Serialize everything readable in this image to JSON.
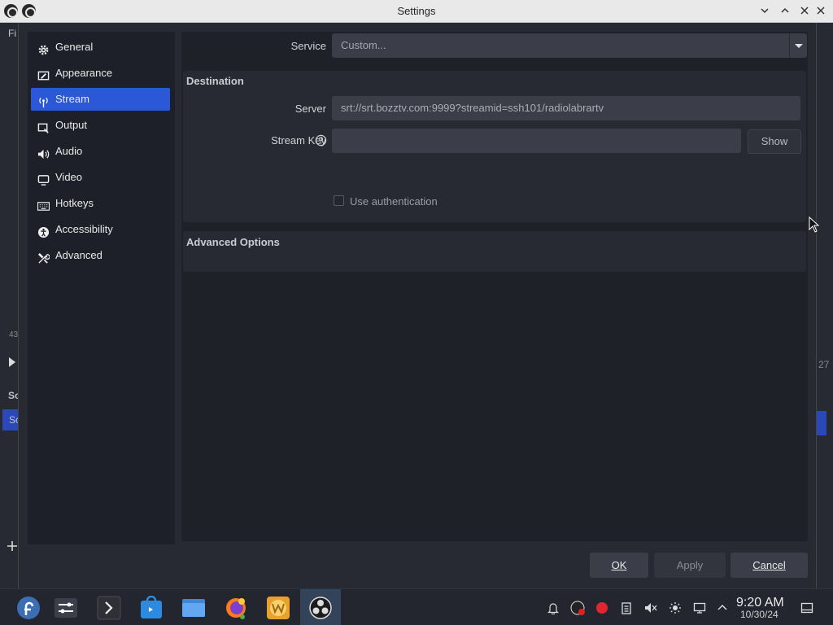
{
  "window": {
    "title": "Settings",
    "background_fragments": {
      "menu_letter": "Fi",
      "number_left": "43",
      "number_right": "27",
      "scenes_fragment": "Sc",
      "scene_item": "Sc"
    }
  },
  "sidebar": {
    "items": [
      {
        "label": "General",
        "icon": "gear-icon"
      },
      {
        "label": "Appearance",
        "icon": "appearance-icon"
      },
      {
        "label": "Stream",
        "icon": "antenna-icon",
        "active": true
      },
      {
        "label": "Output",
        "icon": "output-icon"
      },
      {
        "label": "Audio",
        "icon": "speaker-icon"
      },
      {
        "label": "Video",
        "icon": "monitor-icon"
      },
      {
        "label": "Hotkeys",
        "icon": "keyboard-icon"
      },
      {
        "label": "Accessibility",
        "icon": "accessibility-icon"
      },
      {
        "label": "Advanced",
        "icon": "tools-icon"
      }
    ]
  },
  "stream": {
    "service_label": "Service",
    "service_value": "Custom...",
    "destination_title": "Destination",
    "server_label": "Server",
    "server_value": "srt://srt.bozztv.com:9999?streamid=ssh101/radiolabrartv",
    "stream_key_label": "Stream Key",
    "stream_key_value": "",
    "show_button": "Show",
    "use_auth_label": "Use authentication",
    "advanced_options_title": "Advanced Options"
  },
  "footer": {
    "ok": "OK",
    "apply": "Apply",
    "cancel": "Cancel"
  },
  "taskbar": {
    "time": "9:20 AM",
    "date": "10/30/24"
  },
  "colors": {
    "accent": "#2b58d6",
    "dialog_bg": "#272a33",
    "field_bg": "#3b3e48"
  }
}
